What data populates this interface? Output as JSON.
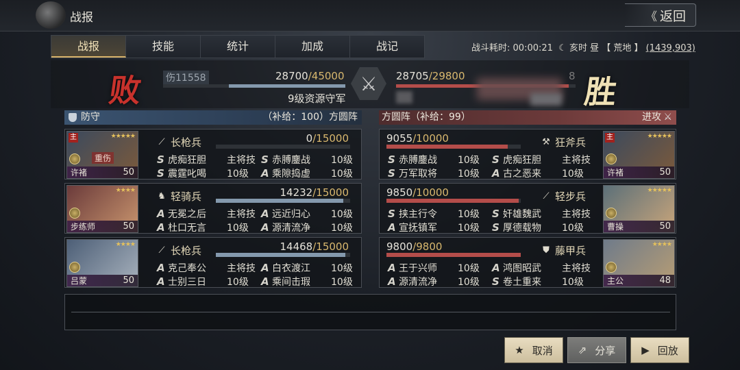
{
  "header": {
    "title": "战报",
    "back_label": "返回"
  },
  "tabs": [
    "战报",
    "技能",
    "统计",
    "加成",
    "战记"
  ],
  "battle_info": {
    "duration_label": "战斗耗时:",
    "duration": "00:00:21",
    "time_of_day": "亥时 昼",
    "location": "【 荒地 】",
    "coords": "(1439,903)"
  },
  "left": {
    "result": "败",
    "damage": "伤11558",
    "troops": "28700",
    "troops_max": "/45000",
    "troops_fraction": 0.6378,
    "opponent_name": "9级资源守军",
    "side_label": "防守",
    "supply": "（补给：100）方圆阵",
    "units": [
      {
        "general": "许褚",
        "level": "50",
        "stars": "★★★★★",
        "main": "主",
        "injured": "重伤",
        "troop_type": "长枪兵",
        "hp": "0",
        "hp_max": "/15000",
        "hp_fraction": 0,
        "skills": [
          {
            "grade": "S",
            "name": "虎痴狂胆",
            "level": "主将技"
          },
          {
            "grade": "S",
            "name": "赤膊鏖战",
            "level": "10级"
          },
          {
            "grade": "S",
            "name": "震霆叱喝",
            "level": "10级"
          },
          {
            "grade": "A",
            "name": "乘隙捣虚",
            "level": "10级"
          }
        ]
      },
      {
        "general": "步练师",
        "level": "50",
        "stars": "★★★★",
        "troop_type": "轻骑兵",
        "hp": "14232",
        "hp_max": "/15000",
        "hp_fraction": 0.9488,
        "skills": [
          {
            "grade": "A",
            "name": "无冕之后",
            "level": "主将技"
          },
          {
            "grade": "A",
            "name": "远近归心",
            "level": "10级"
          },
          {
            "grade": "A",
            "name": "杜口无言",
            "level": "10级"
          },
          {
            "grade": "A",
            "name": "源清流净",
            "level": "10级"
          }
        ]
      },
      {
        "general": "吕蒙",
        "level": "50",
        "stars": "★★★★",
        "troop_type": "长枪兵",
        "hp": "14468",
        "hp_max": "/15000",
        "hp_fraction": 0.9645,
        "skills": [
          {
            "grade": "A",
            "name": "克己奉公",
            "level": "主将技"
          },
          {
            "grade": "A",
            "name": "白衣渡江",
            "level": "10级"
          },
          {
            "grade": "A",
            "name": "士别三日",
            "level": "10级"
          },
          {
            "grade": "A",
            "name": "乘间击瑕",
            "level": "10级"
          }
        ]
      }
    ]
  },
  "right": {
    "result": "胜",
    "troops": "28705",
    "troops_max": "/29800",
    "troops_fraction": 0.9633,
    "partial_digit": "8",
    "side_label": "进攻",
    "supply": "方圆阵（补给：99）",
    "units": [
      {
        "general": "许褚",
        "level": "50",
        "stars": "★★★★★",
        "main": "主",
        "troop_type": "狂斧兵",
        "hp": "9055",
        "hp_max": "/10000",
        "hp_fraction": 0.9055,
        "skills": [
          {
            "grade": "S",
            "name": "赤膊鏖战",
            "level": "10级"
          },
          {
            "grade": "S",
            "name": "虎痴狂胆",
            "level": "主将技"
          },
          {
            "grade": "S",
            "name": "万军取将",
            "level": "10级"
          },
          {
            "grade": "A",
            "name": "古之恶来",
            "level": "10级"
          }
        ]
      },
      {
        "general": "曹操",
        "level": "50",
        "stars": "★★★★★",
        "troop_type": "轻步兵",
        "hp": "9850",
        "hp_max": "/10000",
        "hp_fraction": 0.985,
        "skills": [
          {
            "grade": "S",
            "name": "挟主行令",
            "level": "10级"
          },
          {
            "grade": "S",
            "name": "奸雄魏武",
            "level": "主将技"
          },
          {
            "grade": "A",
            "name": "宣抚镇军",
            "level": "10级"
          },
          {
            "grade": "S",
            "name": "厚德载物",
            "level": "10级"
          }
        ]
      },
      {
        "general": "主公",
        "level": "48",
        "stars": "★★★★",
        "troop_type": "藤甲兵",
        "hp": "9800",
        "hp_max": "/9800",
        "hp_fraction": 1.0,
        "skills": [
          {
            "grade": "A",
            "name": "王于兴师",
            "level": "10级"
          },
          {
            "grade": "A",
            "name": "鸿图昭武",
            "level": "主将技"
          },
          {
            "grade": "A",
            "name": "源清流净",
            "level": "10级"
          },
          {
            "grade": "S",
            "name": "卷土重来",
            "level": "10级"
          }
        ]
      }
    ]
  },
  "buttons": {
    "cancel": "取消",
    "share": "分享",
    "replay": "回放"
  },
  "colors": {
    "defense_bar": "#8499ad",
    "attack_bar": "#b44d4a",
    "accent_gold": "#d9b86e",
    "lose": "#c8322c"
  }
}
